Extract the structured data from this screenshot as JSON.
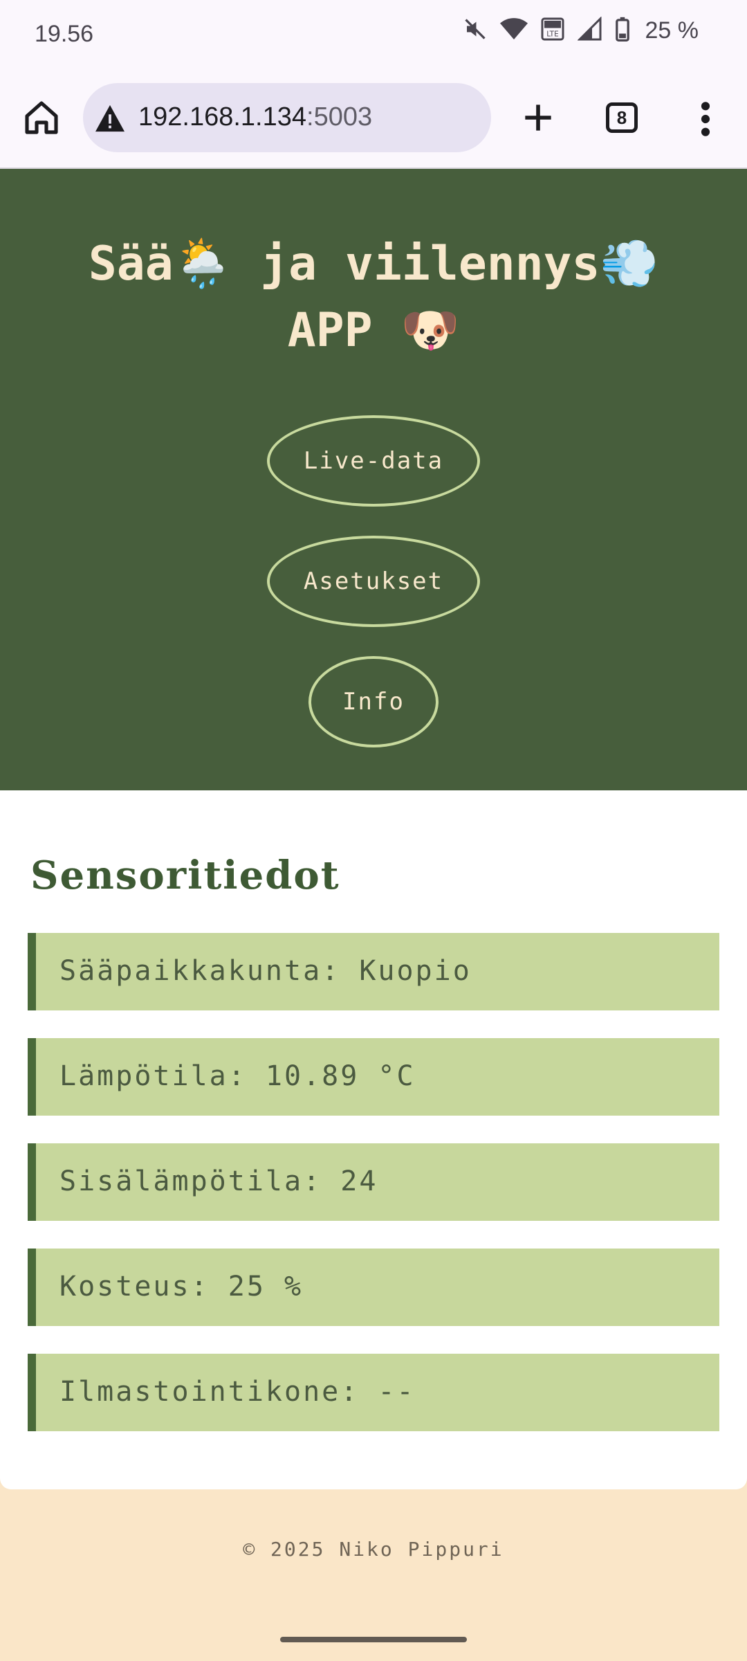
{
  "status_bar": {
    "time": "19.56",
    "battery": "25 %",
    "icons": [
      "mute-icon",
      "wifi-icon",
      "volte-icon",
      "signal-icon",
      "battery-icon"
    ]
  },
  "browser": {
    "url_host": "192.168.1.134",
    "url_port": ":5003",
    "tab_count": "8"
  },
  "header": {
    "title_line1": "Sää🌦️ ja viilennys💨",
    "title_line2": "APP 🐶",
    "nav": [
      "Live-data",
      "Asetukset",
      "Info"
    ]
  },
  "sensor_card": {
    "title": "Sensoritiedot",
    "rows": [
      "Sääpaikkakunta: Kuopio",
      "Lämpötila: 10.89 °C",
      "Sisälämpötila: 24",
      "Kosteus: 25 %",
      "Ilmastointikone: --"
    ]
  },
  "footer": "© 2025 Niko Pippuri",
  "colors": {
    "header_bg": "#475e3c",
    "accent": "#c8da9e",
    "row_bg": "#c7d79c",
    "page_bg": "#fae6c8"
  }
}
